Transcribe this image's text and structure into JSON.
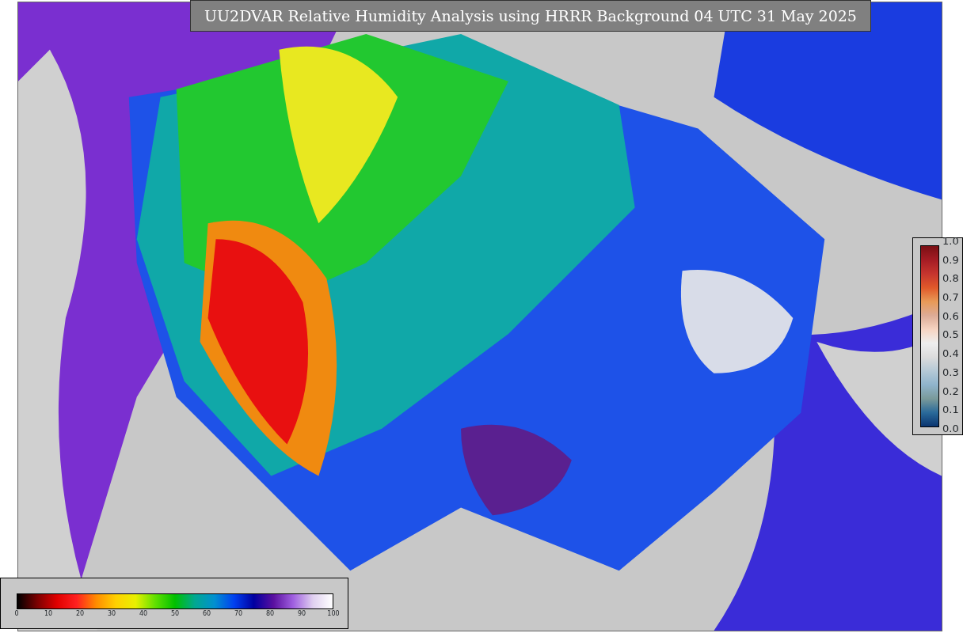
{
  "title": "UU2DVAR Relative Humidity Analysis using HRRR Background 04 UTC 31 May 2025",
  "legend_right": {
    "ticks": [
      "1.0",
      "0.9",
      "0.8",
      "0.7",
      "0.6",
      "0.5",
      "0.4",
      "0.3",
      "0.2",
      "0.1",
      "0.0"
    ]
  },
  "legend_bottom": {
    "ticks": [
      "0",
      "10",
      "20",
      "30",
      "40",
      "50",
      "60",
      "70",
      "80",
      "90",
      "100"
    ]
  }
}
